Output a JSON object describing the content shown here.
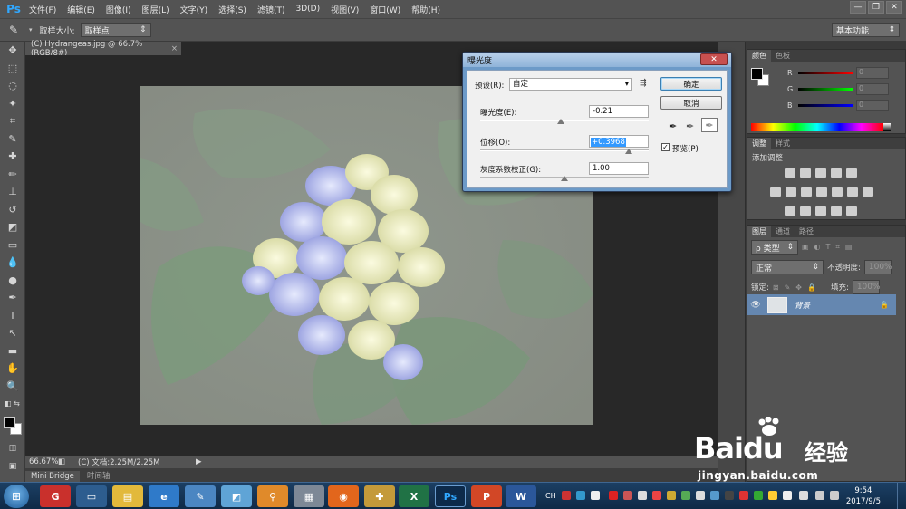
{
  "menubar": {
    "logo": "Ps",
    "items": [
      "文件(F)",
      "编辑(E)",
      "图像(I)",
      "图层(L)",
      "文字(Y)",
      "选择(S)",
      "滤镜(T)",
      "3D(D)",
      "视图(V)",
      "窗口(W)",
      "帮助(H)"
    ],
    "win_controls": [
      "—",
      "❐",
      "✕"
    ]
  },
  "optionsbar": {
    "sample_size_label": "取样大小:",
    "sample_size_value": "取样点",
    "workspace": "基本功能"
  },
  "document": {
    "tab_title": "(C) Hydrangeas.jpg @ 66.7%(RGB/8#)",
    "tab_close": "×",
    "zoom": "66.67%",
    "doc_info": "(C) 文档:2.25M/2.25M"
  },
  "bottom_tabs": [
    "Mini Bridge",
    "时间轴"
  ],
  "panels": {
    "color": {
      "tabs": [
        "颜色",
        "色板"
      ],
      "channels": [
        "R",
        "G",
        "B"
      ],
      "values": [
        "0",
        "0",
        "0"
      ]
    },
    "adjustments": {
      "tabs": [
        "调整",
        "样式"
      ],
      "title": "添加调整"
    },
    "layers": {
      "tabs": [
        "图层",
        "通道",
        "路径"
      ],
      "filter_label": "ρ 类型",
      "blend_mode": "正常",
      "opacity_label": "不透明度:",
      "opacity_value": "100%",
      "lock_label": "锁定:",
      "fill_label": "填充:",
      "fill_value": "100%",
      "layer_name": "背景"
    }
  },
  "dialog": {
    "title": "曝光度",
    "close": "✕",
    "preset_label": "预设(R):",
    "preset_value": "自定",
    "exposure_label": "曝光度(E):",
    "exposure_value": "-0.21",
    "exposure_fraction": 0.48,
    "offset_label": "位移(O):",
    "offset_value": "+0.3968",
    "offset_fraction": 0.88,
    "gamma_label": "灰度系数校正(G):",
    "gamma_value": "1.00",
    "gamma_fraction": 0.5,
    "ok": "确定",
    "cancel": "取消",
    "preview_label": "预览(P)",
    "preview_checked": true
  },
  "taskbar": {
    "time": "9:54",
    "date": "2017/9/5",
    "lang": "CH"
  },
  "watermark": {
    "brand": "Bai",
    "brand2": "du",
    "brand_cn": "经验",
    "url": "jingyan.baidu.com"
  }
}
